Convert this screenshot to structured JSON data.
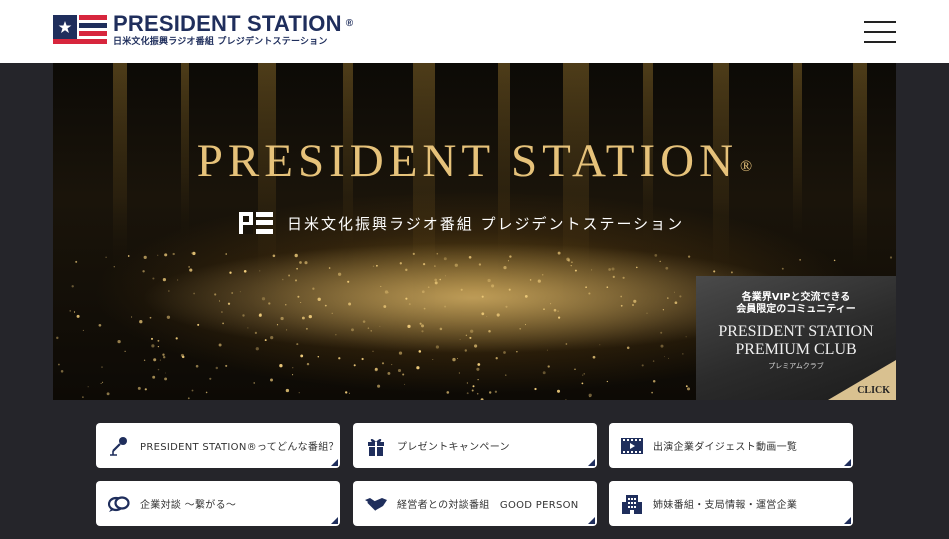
{
  "header": {
    "logo_title": "PRESIDENT STATION",
    "logo_reg": "®",
    "logo_subtitle": "日米文化振興ラジオ番組 プレジデントステーション",
    "menu_icon": "hamburger-menu-icon"
  },
  "hero": {
    "title": "PRESIDENT STATION",
    "title_reg": "®",
    "subtitle": "日米文化振興ラジオ番組 プレジデントステーション"
  },
  "premium_club": {
    "line1": "各業界VIPと交流できる",
    "line2": "会員限定のコミュニティー",
    "title1": "PRESIDENT STATION",
    "title2": "PREMIUM CLUB",
    "kana": "プレミアムクラブ",
    "click_label": "CLICK"
  },
  "nav_buttons": [
    {
      "label": "PRESIDENT STATION®ってどんな番組？",
      "icon": "microphone-icon"
    },
    {
      "label": "プレゼントキャンペーン",
      "icon": "gift-icon"
    },
    {
      "label": "出演企業ダイジェスト動画一覧",
      "icon": "film-icon"
    },
    {
      "label": "企業対談 ～繋がる～",
      "icon": "speech-bubbles-icon"
    },
    {
      "label": "経営者との対談番組　GOOD PERSON",
      "icon": "handshake-icon"
    },
    {
      "label": "姉妹番組・支局情報・運営企業",
      "icon": "building-icon"
    }
  ],
  "colors": {
    "navy": "#1f2e5c",
    "red": "#d7263d",
    "gold": "#e6c27a",
    "background": "#25252a"
  }
}
